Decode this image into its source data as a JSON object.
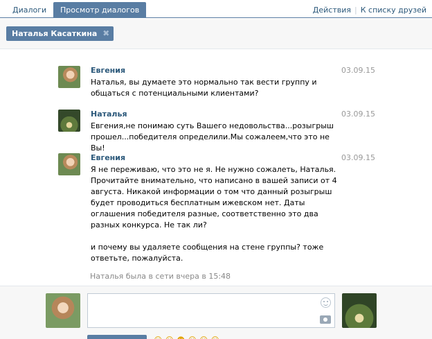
{
  "tabs": {
    "dialogs": "Диалоги",
    "view_dialogs": "Просмотр диалогов"
  },
  "top_links": {
    "actions": "Действия",
    "to_friends": "К списку друзей"
  },
  "participant": {
    "name": "Наталья Касаткина"
  },
  "messages": [
    {
      "author": "Евгения",
      "date": "03.09.15",
      "paragraphs": [
        "Наталья, вы думаете это нормально так вести группу и общаться с потенциальными клиентами?"
      ]
    },
    {
      "author": "Наталья",
      "date": "03.09.15",
      "paragraphs": [
        "Евгения,не понимаю суть Вашего недовольства...розыгрыш прошел...победителя определили.Мы сожалеем,что это не Вы!"
      ]
    },
    {
      "author": "Евгения",
      "date": "03.09.15",
      "paragraphs": [
        "Я не переживаю, что это не я. Не нужно сожалеть, Наталья. Прочитайте внимательно, что написано в вашей записи от 4 августа. Никакой информации о том что данный розыгрыш будет проводиться бесплатным ижевском нет. Даты оглашения победителя разные, соответственно это два разных конкурса. Не так ли?",
        "и почему вы удаляете сообщения на стене группы? тоже ответьте, пожалуйста."
      ]
    }
  ],
  "status_text": "Наталья была в сети вчера в 15:48",
  "compose": {
    "emoji_icon": "smile-icon",
    "attach_icon": "camera-icon",
    "smiles_row": "☺☺☻☺☺☺"
  },
  "colors": {
    "accent": "#597da3",
    "link": "#2b587a",
    "muted": "#999999"
  }
}
